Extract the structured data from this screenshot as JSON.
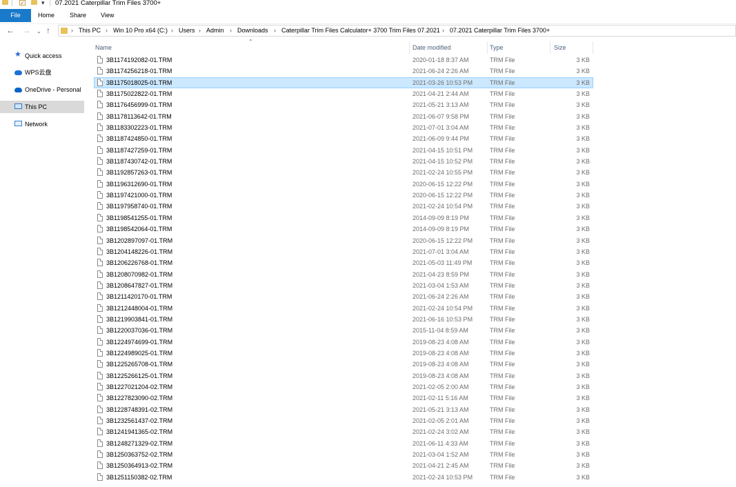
{
  "window": {
    "title": "07.2021 Caterpillar Trim Files 3700+"
  },
  "ribbon": {
    "tabs": [
      {
        "label": "File"
      },
      {
        "label": "Home"
      },
      {
        "label": "Share"
      },
      {
        "label": "View"
      }
    ]
  },
  "address": {
    "crumbs": [
      "This PC",
      "Win 10 Pro x64 (C:)",
      "Users",
      "Admin",
      "Downloads",
      "Caterpillar Trim Files Calculator+ 3700 Trim Files 07.2021",
      "07.2021 Caterpillar Trim Files 3700+"
    ]
  },
  "navpane": {
    "items": [
      {
        "label": "Quick access",
        "icon": "star-icon"
      },
      {
        "label": "WPS云盘",
        "icon": "wps-cloud-icon"
      },
      {
        "label": "OneDrive - Personal",
        "icon": "onedrive-icon"
      },
      {
        "label": "This PC",
        "icon": "computer-icon",
        "selected": true
      },
      {
        "label": "Network",
        "icon": "network-icon"
      }
    ]
  },
  "columns": {
    "name": "Name",
    "date": "Date modified",
    "type": "Type",
    "size": "Size"
  },
  "files": [
    {
      "name": "3B1174192082-01.TRM",
      "date": "2020-01-18 8:37 AM",
      "type": "TRM File",
      "size": "3 KB"
    },
    {
      "name": "3B1174256218-01.TRM",
      "date": "2021-06-24 2:26 AM",
      "type": "TRM File",
      "size": "3 KB"
    },
    {
      "name": "3B1175018025-01.TRM",
      "date": "2021-03-26 10:53 PM",
      "type": "TRM File",
      "size": "3 KB",
      "selected": true
    },
    {
      "name": "3B1175022822-01.TRM",
      "date": "2021-04-21 2:44 AM",
      "type": "TRM File",
      "size": "3 KB"
    },
    {
      "name": "3B1176456999-01.TRM",
      "date": "2021-05-21 3:13 AM",
      "type": "TRM File",
      "size": "3 KB"
    },
    {
      "name": "3B1178113642-01.TRM",
      "date": "2021-06-07 9:58 PM",
      "type": "TRM File",
      "size": "3 KB"
    },
    {
      "name": "3B1183302223-01.TRM",
      "date": "2021-07-01 3:04 AM",
      "type": "TRM File",
      "size": "3 KB"
    },
    {
      "name": "3B1187424850-01.TRM",
      "date": "2021-06-09 9:44 PM",
      "type": "TRM File",
      "size": "3 KB"
    },
    {
      "name": "3B1187427259-01.TRM",
      "date": "2021-04-15 10:51 PM",
      "type": "TRM File",
      "size": "3 KB"
    },
    {
      "name": "3B1187430742-01.TRM",
      "date": "2021-04-15 10:52 PM",
      "type": "TRM File",
      "size": "3 KB"
    },
    {
      "name": "3B1192857263-01.TRM",
      "date": "2021-02-24 10:55 PM",
      "type": "TRM File",
      "size": "3 KB"
    },
    {
      "name": "3B1196312690-01.TRM",
      "date": "2020-06-15 12:22 PM",
      "type": "TRM File",
      "size": "3 KB"
    },
    {
      "name": "3B1197421000-01.TRM",
      "date": "2020-06-15 12:22 PM",
      "type": "TRM File",
      "size": "3 KB"
    },
    {
      "name": "3B1197958740-01.TRM",
      "date": "2021-02-24 10:54 PM",
      "type": "TRM File",
      "size": "3 KB"
    },
    {
      "name": "3B1198541255-01.TRM",
      "date": "2014-09-09 8:19 PM",
      "type": "TRM File",
      "size": "3 KB"
    },
    {
      "name": "3B1198542064-01.TRM",
      "date": "2014-09-09 8:19 PM",
      "type": "TRM File",
      "size": "3 KB"
    },
    {
      "name": "3B1202897097-01.TRM",
      "date": "2020-06-15 12:22 PM",
      "type": "TRM File",
      "size": "3 KB"
    },
    {
      "name": "3B1204148226-01.TRM",
      "date": "2021-07-01 3:04 AM",
      "type": "TRM File",
      "size": "3 KB"
    },
    {
      "name": "3B1206226768-01.TRM",
      "date": "2021-05-03 11:49 PM",
      "type": "TRM File",
      "size": "3 KB"
    },
    {
      "name": "3B1208070982-01.TRM",
      "date": "2021-04-23 8:59 PM",
      "type": "TRM File",
      "size": "3 KB"
    },
    {
      "name": "3B1208647827-01.TRM",
      "date": "2021-03-04 1:53 AM",
      "type": "TRM File",
      "size": "3 KB"
    },
    {
      "name": "3B1211420170-01.TRM",
      "date": "2021-06-24 2:26 AM",
      "type": "TRM File",
      "size": "3 KB"
    },
    {
      "name": "3B1212448004-01.TRM",
      "date": "2021-02-24 10:54 PM",
      "type": "TRM File",
      "size": "3 KB"
    },
    {
      "name": "3B1219903841-01.TRM",
      "date": "2021-06-16 10:53 PM",
      "type": "TRM File",
      "size": "3 KB"
    },
    {
      "name": "3B1220037036-01.TRM",
      "date": "2015-11-04 8:59 AM",
      "type": "TRM File",
      "size": "3 KB"
    },
    {
      "name": "3B1224974699-01.TRM",
      "date": "2019-08-23 4:08 AM",
      "type": "TRM File",
      "size": "3 KB"
    },
    {
      "name": "3B1224989025-01.TRM",
      "date": "2019-08-23 4:08 AM",
      "type": "TRM File",
      "size": "3 KB"
    },
    {
      "name": "3B1225265708-01.TRM",
      "date": "2019-08-23 4:08 AM",
      "type": "TRM File",
      "size": "3 KB"
    },
    {
      "name": "3B1225266125-01.TRM",
      "date": "2019-08-23 4:08 AM",
      "type": "TRM File",
      "size": "3 KB"
    },
    {
      "name": "3B1227021204-02.TRM",
      "date": "2021-02-05 2:00 AM",
      "type": "TRM File",
      "size": "3 KB"
    },
    {
      "name": "3B1227823090-02.TRM",
      "date": "2021-02-11 5:16 AM",
      "type": "TRM File",
      "size": "3 KB"
    },
    {
      "name": "3B1228748391-02.TRM",
      "date": "2021-05-21 3:13 AM",
      "type": "TRM File",
      "size": "3 KB"
    },
    {
      "name": "3B1232561437-02.TRM",
      "date": "2021-02-05 2:01 AM",
      "type": "TRM File",
      "size": "3 KB"
    },
    {
      "name": "3B1241941365-02.TRM",
      "date": "2021-02-24 3:02 AM",
      "type": "TRM File",
      "size": "3 KB"
    },
    {
      "name": "3B1248271329-02.TRM",
      "date": "2021-06-11 4:33 AM",
      "type": "TRM File",
      "size": "3 KB"
    },
    {
      "name": "3B1250363752-02.TRM",
      "date": "2021-03-04 1:52 AM",
      "type": "TRM File",
      "size": "3 KB"
    },
    {
      "name": "3B1250364913-02.TRM",
      "date": "2021-04-21 2:45 AM",
      "type": "TRM File",
      "size": "3 KB"
    },
    {
      "name": "3B1251150382-02.TRM",
      "date": "2021-02-24 10:53 PM",
      "type": "TRM File",
      "size": "3 KB"
    }
  ]
}
